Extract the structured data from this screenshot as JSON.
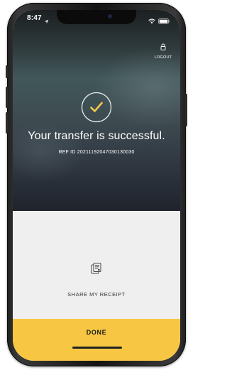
{
  "status_bar": {
    "time": "8:47"
  },
  "header": {
    "logout_label": "LOGOUT"
  },
  "confirmation": {
    "headline": "Your transfer is successful.",
    "reference": "REF ID 20211192047030130030"
  },
  "actions": {
    "share_label": "SHARE MY RECEIPT",
    "done_label": "DONE"
  },
  "colors": {
    "accent": "#f7c744",
    "check_color": "#f2c94c"
  },
  "icons": {
    "success": "checkmark-circle-icon",
    "logout": "lock-icon",
    "share": "receipt-icon"
  }
}
